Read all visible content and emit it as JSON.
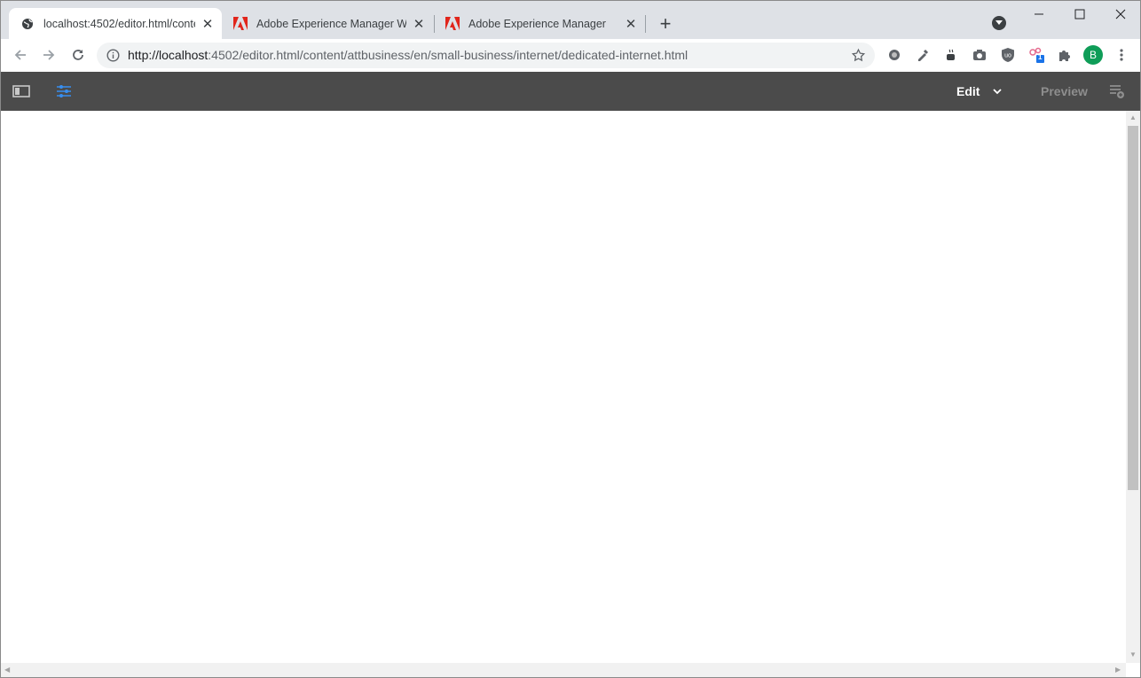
{
  "browser": {
    "tabs": [
      {
        "title": "localhost:4502/editor.html/conte",
        "icon": "globe-icon",
        "active": true
      },
      {
        "title": "Adobe Experience Manager Web",
        "icon": "adobe-icon",
        "active": false
      },
      {
        "title": "Adobe Experience Manager",
        "icon": "adobe-icon",
        "active": false
      }
    ],
    "url_scheme_host": "http://localhost",
    "url_rest": ":4502/editor.html/content/attbusiness/en/small-business/internet/dedicated-internet.html",
    "profile_initial": "B",
    "extension_badge": "1",
    "colors": {
      "tabstrip": "#dee1e6",
      "omnibox": "#f1f3f4",
      "avatar": "#0f9d58",
      "adobe_red": "#e1251b"
    }
  },
  "aem": {
    "mode_label": "Edit",
    "preview_label": "Preview",
    "colors": {
      "bar": "#4b4b4b",
      "active_icon": "#378ef0"
    }
  }
}
